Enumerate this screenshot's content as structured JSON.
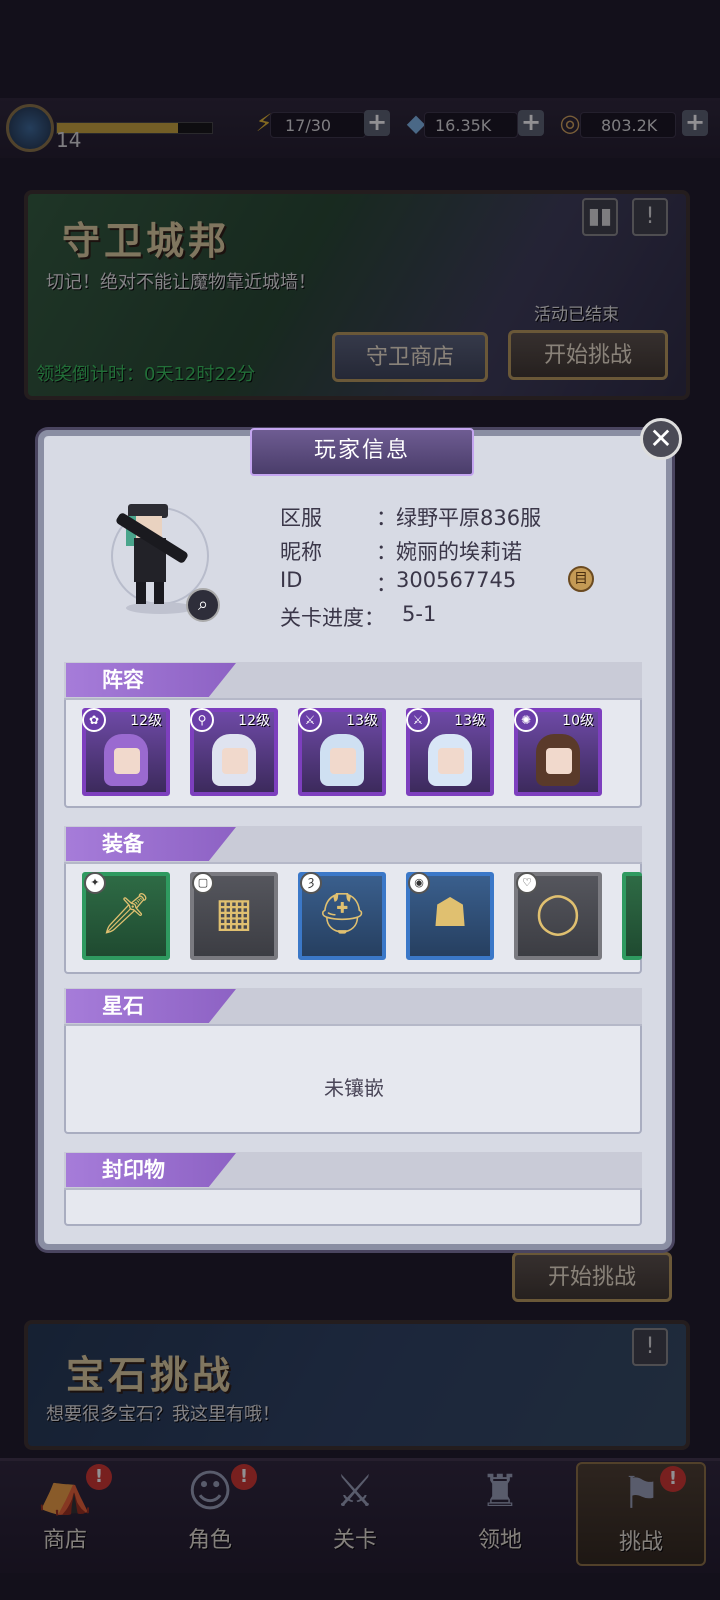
{
  "topbar": {
    "level": "14",
    "xp_fraction": 0.78,
    "stamina": "17/30",
    "gems": "16.35K",
    "coins": "803.2K",
    "plus": "+",
    "icons": [
      "lightning-icon",
      "crystal-icon",
      "coin-icon"
    ]
  },
  "event1": {
    "title": "守卫城邦",
    "subtitle": "切记！绝对不能让魔物靠近城墙！",
    "status": "活动已结束",
    "countdown": "领奖倒计时：0天12时22分",
    "shop_button": "守卫商店",
    "start_button": "开始挑战",
    "rank_icon": "▮▮",
    "alert_icon": "!"
  },
  "event2": {
    "title": "宝石挑战",
    "subtitle": "想要很多宝石？我这里有哦！",
    "start_button": "开始挑战",
    "alert_icon": "!"
  },
  "modal": {
    "title": "玩家信息",
    "close": "✕",
    "info": [
      {
        "label": "区服",
        "value": "绿野平原836服"
      },
      {
        "label": "昵称",
        "value": "婉丽的埃莉诺"
      },
      {
        "label": "ID",
        "value": "300567745"
      },
      {
        "label": "关卡进度：",
        "value": "5-1"
      }
    ],
    "colon": "：",
    "copy_icon": "目",
    "sections": {
      "lineup": "阵容",
      "equipment": "装备",
      "starstone": "星石",
      "seal": "封印物"
    },
    "heroes": [
      {
        "level": "12级",
        "badge": "✿"
      },
      {
        "level": "12级",
        "badge": "⚲"
      },
      {
        "level": "13级",
        "badge": "⚔"
      },
      {
        "level": "13级",
        "badge": "⚔"
      },
      {
        "level": "10级",
        "badge": "✺"
      }
    ],
    "equipment": [
      {
        "badge": "✦",
        "glyph": "🗡",
        "rarity": "green"
      },
      {
        "badge": "▢",
        "glyph": "▦",
        "rarity": "gray"
      },
      {
        "badge": "Ȝ",
        "glyph": "⛑",
        "rarity": "blue"
      },
      {
        "badge": "◉",
        "glyph": "☗",
        "rarity": "blue"
      },
      {
        "badge": "♡",
        "glyph": "◯",
        "rarity": "gray"
      }
    ],
    "starstone_empty": "未镶嵌"
  },
  "nav": {
    "items": [
      {
        "label": "商店",
        "icon": "⛺",
        "alert": "!"
      },
      {
        "label": "角色",
        "icon": "☺",
        "alert": "!"
      },
      {
        "label": "关卡",
        "icon": "⚔",
        "alert": ""
      },
      {
        "label": "领地",
        "icon": "♜",
        "alert": ""
      },
      {
        "label": "挑战",
        "icon": "⚑",
        "alert": "!"
      }
    ]
  }
}
